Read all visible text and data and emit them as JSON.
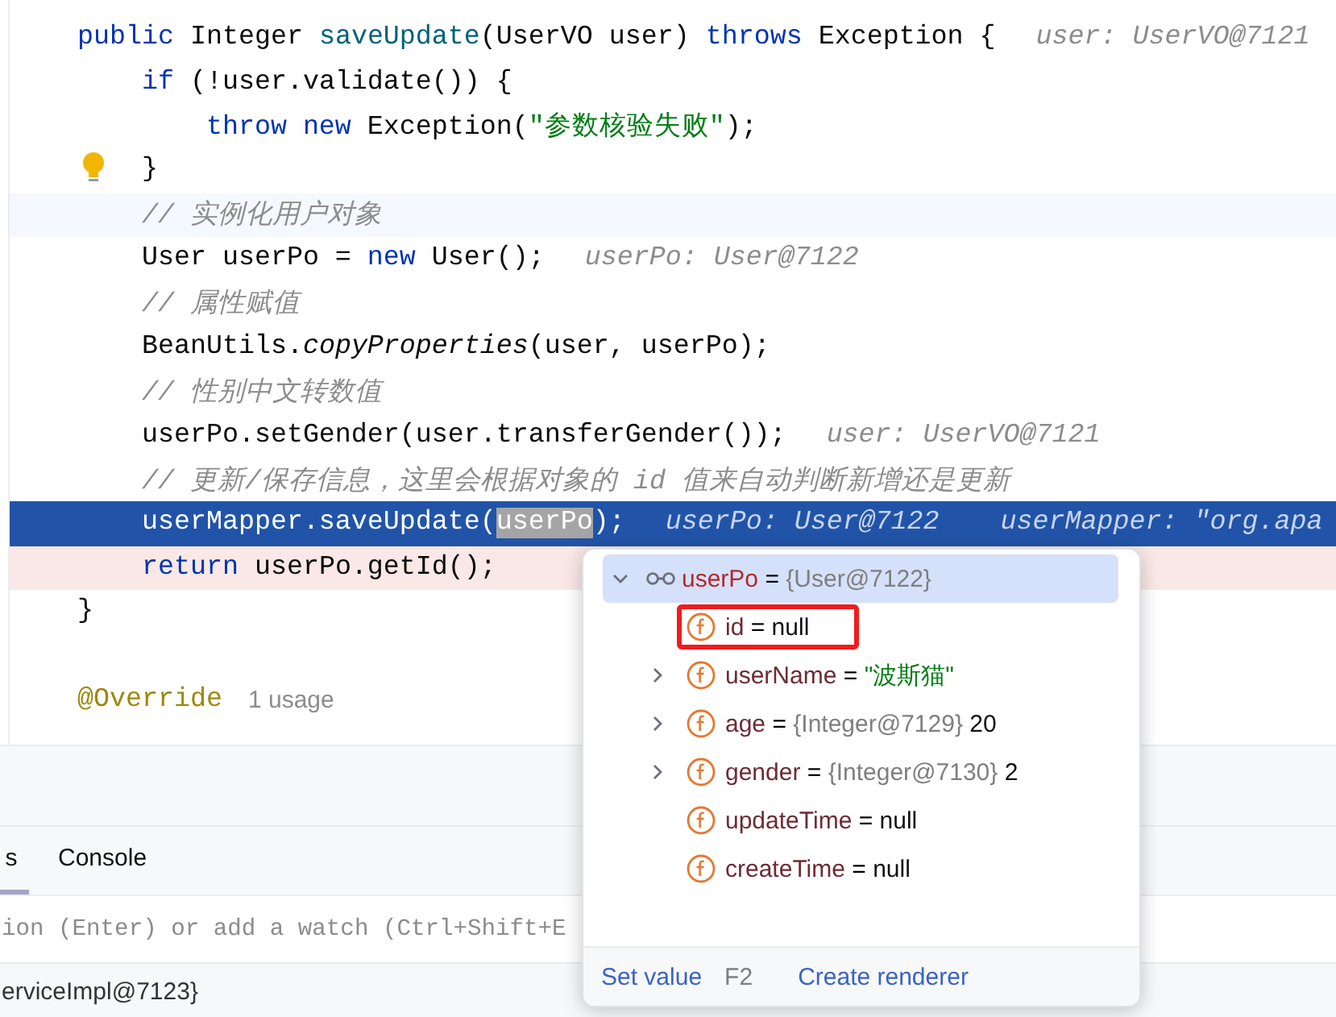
{
  "editor": {
    "lines": [
      {
        "kind": "plain",
        "bulb": false,
        "tokens": [
          {
            "text": "public",
            "kind": "kw"
          },
          {
            "text": " Integer ",
            "kind": "plain"
          },
          {
            "text": "saveUpdate",
            "kind": "decl"
          },
          {
            "text": "(UserVO user) ",
            "kind": "plain"
          },
          {
            "text": "throws",
            "kind": "kw"
          },
          {
            "text": " Exception {",
            "kind": "plain"
          }
        ],
        "hints": [
          {
            "text": "user: UserVO@7121",
            "kind": "value"
          }
        ]
      },
      {
        "kind": "plain",
        "bulb": false,
        "tokens": [
          {
            "text": "    if",
            "kind": "kw"
          },
          {
            "text": " (!user.validate()) {",
            "kind": "plain"
          }
        ]
      },
      {
        "kind": "plain",
        "bulb": false,
        "tokens": [
          {
            "text": "        throw new",
            "kind": "kw"
          },
          {
            "text": " Exception(",
            "kind": "plain"
          },
          {
            "text": "\"参数核验失败\"",
            "kind": "str"
          },
          {
            "text": ");",
            "kind": "plain"
          }
        ]
      },
      {
        "kind": "plain",
        "bulb": true,
        "tokens": [
          {
            "text": "    }",
            "kind": "plain"
          }
        ]
      },
      {
        "kind": "caret",
        "bulb": false,
        "tokens": [
          {
            "text": "    // 实例化用户对象",
            "kind": "comment"
          }
        ]
      },
      {
        "kind": "plain",
        "bulb": false,
        "tokens": [
          {
            "text": "    User userPo = ",
            "kind": "plain"
          },
          {
            "text": "new",
            "kind": "kw"
          },
          {
            "text": " User();",
            "kind": "plain"
          }
        ],
        "hints": [
          {
            "text": "userPo: User@7122",
            "kind": "value"
          }
        ]
      },
      {
        "kind": "plain",
        "bulb": false,
        "tokens": [
          {
            "text": "    // 属性赋值",
            "kind": "comment"
          }
        ]
      },
      {
        "kind": "plain",
        "bulb": false,
        "tokens": [
          {
            "text": "    BeanUtils.",
            "kind": "plain"
          },
          {
            "text": "copyProperties",
            "kind": "static"
          },
          {
            "text": "(user, userPo);",
            "kind": "plain"
          }
        ]
      },
      {
        "kind": "plain",
        "bulb": false,
        "tokens": [
          {
            "text": "    // 性别中文转数值",
            "kind": "comment"
          }
        ]
      },
      {
        "kind": "plain",
        "bulb": false,
        "tokens": [
          {
            "text": "    userPo.setGender(user.transferGender());",
            "kind": "plain"
          }
        ],
        "hints": [
          {
            "text": "user: UserVO@7121",
            "kind": "value"
          }
        ]
      },
      {
        "kind": "plain",
        "bulb": false,
        "tokens": [
          {
            "text": "    // 更新/保存信息，这里会根据对象的 id 值来自动判断新增还是更新",
            "kind": "comment"
          }
        ]
      },
      {
        "kind": "execution",
        "bulb": false,
        "tokens": [
          {
            "text": "    userMapper.saveUpdate(",
            "kind": "plain"
          },
          {
            "text": "userPo",
            "kind": "sel"
          },
          {
            "text": ");",
            "kind": "plain"
          }
        ],
        "hints": [
          {
            "text": "userPo: User@7122",
            "kind": "value"
          },
          {
            "text": "userMapper: \"org.apa",
            "kind": "value"
          }
        ]
      },
      {
        "kind": "frame",
        "bulb": false,
        "tokens": [
          {
            "text": "    return",
            "kind": "kw"
          },
          {
            "text": " userPo.getId();",
            "kind": "plain"
          }
        ]
      },
      {
        "kind": "plain",
        "bulb": false,
        "tokens": [
          {
            "text": "}",
            "kind": "plain"
          }
        ]
      },
      {
        "kind": "blank",
        "bulb": false
      },
      {
        "kind": "plain",
        "bulb": false,
        "tokens": [
          {
            "text": "@Override",
            "kind": "annot"
          }
        ],
        "hints": [
          {
            "text": "1 usage",
            "kind": "usage"
          }
        ]
      }
    ]
  },
  "debug_panel": {
    "tabs": [
      {
        "label": "s",
        "selected": true
      },
      {
        "label": "Console",
        "selected": false
      }
    ],
    "watch_input": {
      "placeholder": "ion (Enter) or add a watch (Ctrl+Shift+E"
    },
    "variable_row": "erviceImpl@7123}"
  },
  "popup": {
    "root": {
      "name": "userPo",
      "op": "=",
      "ref": "{User@7122}",
      "expanded": true,
      "selected": true,
      "children": [
        {
          "name": "id",
          "op": "=",
          "value": "null",
          "kind": "plain",
          "expandable": false,
          "marked": true
        },
        {
          "name": "userName",
          "op": "=",
          "value": "\"波斯猫\"",
          "kind": "string",
          "expandable": true,
          "marked": false
        },
        {
          "name": "age",
          "op": "=",
          "ref": "{Integer@7129}",
          "value": "20",
          "kind": "plain",
          "expandable": true,
          "marked": false
        },
        {
          "name": "gender",
          "op": "=",
          "ref": "{Integer@7130}",
          "value": "2",
          "kind": "plain",
          "expandable": true,
          "marked": false
        },
        {
          "name": "updateTime",
          "op": "=",
          "value": "null",
          "kind": "plain",
          "expandable": false,
          "marked": false
        },
        {
          "name": "createTime",
          "op": "=",
          "value": "null",
          "kind": "plain",
          "expandable": false,
          "marked": false
        }
      ]
    },
    "footer": {
      "action": "Set value",
      "shortcut": "F2",
      "link": "Create renderer"
    }
  }
}
